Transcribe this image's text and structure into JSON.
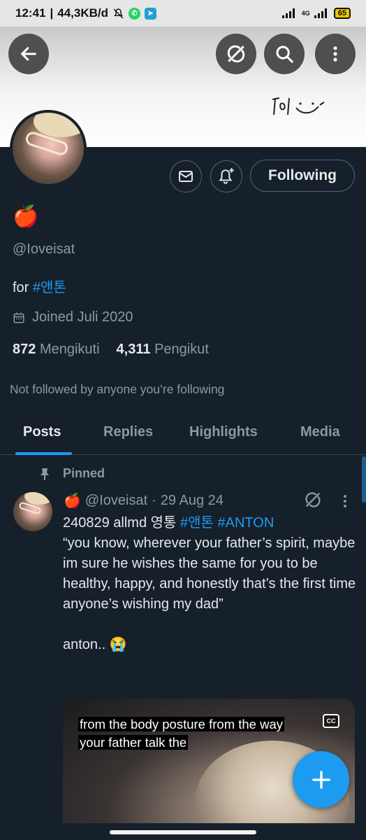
{
  "status_bar": {
    "time": "12:41",
    "speed": "44,3KB/d",
    "network": "4G",
    "battery": "65"
  },
  "profile": {
    "display_name": "🍎",
    "handle": "@Ioveisat",
    "bio_prefix": "for",
    "bio_hashtag": "#앤톤",
    "joined": "Joined Juli 2020",
    "following_count": "872",
    "following_label": "Mengikuti",
    "followers_count": "4,311",
    "followers_label": "Pengikut",
    "not_followed": "Not followed by anyone you’re following",
    "follow_button": "Following"
  },
  "tabs": [
    {
      "label": "Posts",
      "active": true
    },
    {
      "label": "Replies",
      "active": false
    },
    {
      "label": "Highlights",
      "active": false
    },
    {
      "label": "Media",
      "active": false
    }
  ],
  "post": {
    "pinned_label": "Pinned",
    "author_emoji": "🍎",
    "author_handle": "@Ioveisat",
    "separator": "·",
    "date": "29 Aug 24",
    "line1_text": "240829 allmd 영통",
    "line1_tag1": "#앤톤",
    "line1_tag2": "#ANTON",
    "body": "“you know, wherever your father’s spirit, maybe im sure he wishes the same for you to be healthy, happy, and honestly that’s the first time anyone’s wishing my dad”\n\nanton.. 😭",
    "caption_line1": "from the body posture from the way",
    "caption_line2": "your father talk the",
    "cc_label": "CC"
  },
  "icons": {
    "back": "back-arrow-icon",
    "grok": "grok-icon",
    "search": "search-icon",
    "more": "more-vertical-icon",
    "message": "envelope-icon",
    "notify": "bell-plus-icon",
    "calendar": "calendar-icon",
    "pin": "pin-icon",
    "compose": "plus-icon"
  },
  "colors": {
    "background": "#15202b",
    "accent": "#1d9bf0",
    "secondary_text": "#8b98a5"
  }
}
